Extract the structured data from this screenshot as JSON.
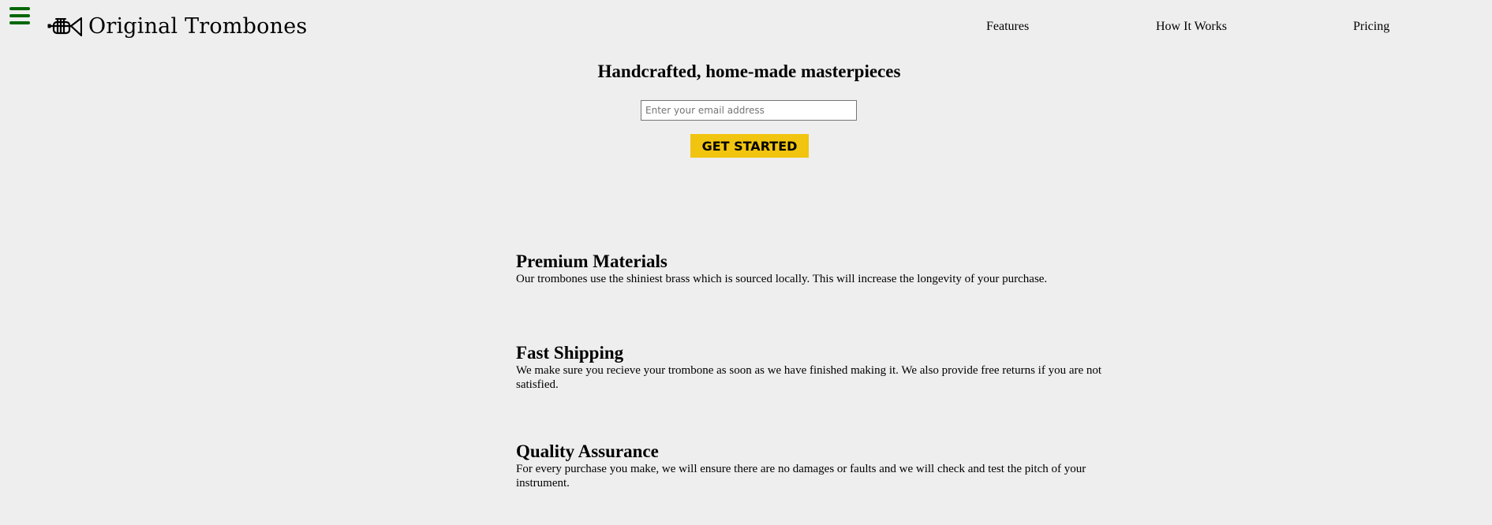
{
  "header": {
    "brand": "Original Trombones",
    "menu_icon": "hamburger-menu-icon",
    "logo_icon": "trombone-icon",
    "accent_color": "#006600",
    "nav": [
      {
        "label": "Features"
      },
      {
        "label": "How It Works"
      },
      {
        "label": "Pricing"
      }
    ]
  },
  "hero": {
    "title": "Handcrafted, home-made masterpieces",
    "email_placeholder": "Enter your email address",
    "cta_label": "GET STARTED",
    "cta_color": "#f1c40f"
  },
  "features": [
    {
      "title": "Premium Materials",
      "text": "Our trombones use the shiniest brass which is sourced locally. This will increase the longevity of your purchase."
    },
    {
      "title": "Fast Shipping",
      "text": "We make sure you recieve your trombone as soon as we have finished making it. We also provide free returns if you are not satisfied."
    },
    {
      "title": "Quality Assurance",
      "text": "For every purchase you make, we will ensure there are no damages or faults and we will check and test the pitch of your instrument."
    }
  ]
}
